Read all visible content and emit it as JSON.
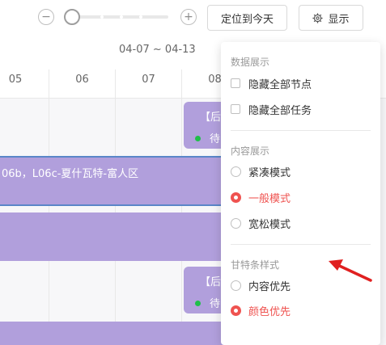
{
  "toolbar": {
    "zoom_out": "−",
    "zoom_in": "+",
    "today_button": "定位到今天",
    "display_button": "显示",
    "display_icon": "gear-icon"
  },
  "timeline": {
    "week_range": "04-07 ~ 04-13",
    "days": [
      "05",
      "06",
      "07",
      "08"
    ]
  },
  "gantt": {
    "bar_label": "06b，L06c-夏什瓦特-富人区",
    "card_title": "【后",
    "card_status": "待"
  },
  "display_panel": {
    "data_section": {
      "title": "数据展示",
      "options": [
        "隐藏全部节点",
        "隐藏全部任务"
      ]
    },
    "content_section": {
      "title": "内容展示",
      "options": [
        "紧凑模式",
        "一般模式",
        "宽松模式"
      ],
      "selected": "一般模式"
    },
    "bar_style_section": {
      "title": "甘特条样式",
      "options": [
        "内容优先",
        "颜色优先"
      ],
      "selected": "颜色优先"
    }
  },
  "colors": {
    "accent_red": "#ef5350",
    "bar_purple": "#b19fdc",
    "status_green": "#1fbf4a",
    "arrow_red": "#e02020"
  }
}
